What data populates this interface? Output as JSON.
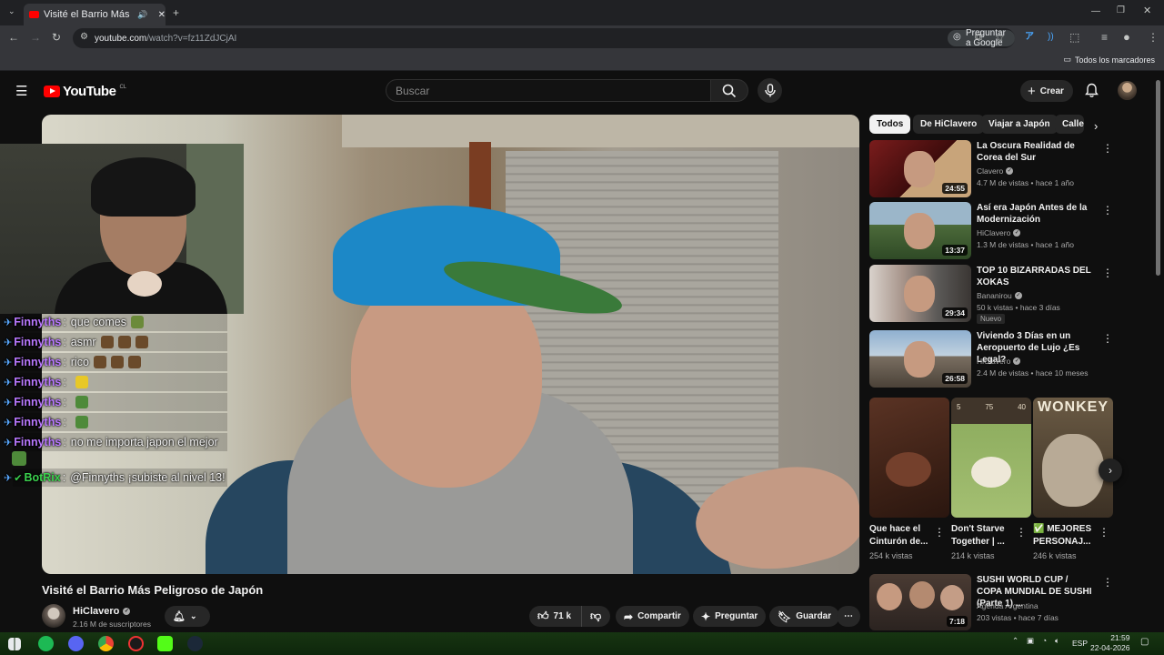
{
  "browser": {
    "tab_title": "Visité el Barrio Más Peligroso de Japón - YouTube",
    "url_host": "youtube.com",
    "url_path": "/watch?v=fz11ZdJCjAI",
    "google_pill": "Preguntar a Google",
    "bookmarks_all": "Todos los marcadores",
    "icons": [
      "back-icon",
      "forward-icon",
      "reload-icon",
      "site-info-icon",
      "bookmark-star-icon",
      "extensions-icon",
      "profile-icon",
      "menu-icon"
    ]
  },
  "youtube": {
    "logo_text": "YouTube",
    "country_code": "CL",
    "search_placeholder": "Buscar",
    "create_label": "Crear"
  },
  "stream_overlay": {
    "chat": [
      {
        "user": "Finnyths",
        "text": "que comes",
        "emote_colors": [
          "#6b8a3a"
        ]
      },
      {
        "user": "Finnyths",
        "text": "asmr",
        "emote_colors": [
          "#6a4a2a",
          "#6a4a2a",
          "#6a4a2a"
        ]
      },
      {
        "user": "Finnyths",
        "text": "rico",
        "emote_colors": [
          "#6a4a2a",
          "#6a4a2a",
          "#6a4a2a"
        ]
      },
      {
        "user": "Finnyths",
        "text": "",
        "emote_colors": [
          "#e8c827"
        ]
      },
      {
        "user": "Finnyths",
        "text": "",
        "emote_colors": [
          "#4e8a3a"
        ]
      },
      {
        "user": "Finnyths",
        "text": "",
        "emote_colors": [
          "#4e8a3a"
        ]
      },
      {
        "user": "Finnyths",
        "text": "no me importa japon el mejor",
        "emote_colors": []
      },
      {
        "user": "BotRix",
        "text": "@Finnyths ¡subiste al nivel 13!",
        "emote_colors": []
      }
    ]
  },
  "video": {
    "title": "Visité el Barrio Más Peligroso de Japón",
    "channel": "HiClavero",
    "subscribers": "2.16 M de suscriptores",
    "likes": "71 k",
    "share_label": "Compartir",
    "ask_label": "Preguntar",
    "save_label": "Guardar"
  },
  "chips": [
    "Todos",
    "De HiClavero",
    "Viajar a Japón",
    "Calle"
  ],
  "recommendations": [
    {
      "title": "La Oscura Realidad de Corea del Sur",
      "channel": "Clavero",
      "meta": "4.7 M de vistas • hace 1 año",
      "duration": "24:55",
      "badge": ""
    },
    {
      "title": "Así era Japón Antes de la Modernización",
      "channel": "HiClavero",
      "meta": "1.3 M de vistas • hace 1 año",
      "duration": "13:37",
      "badge": ""
    },
    {
      "title": "TOP 10 BIZARRADAS DEL XOKAS",
      "channel": "Bananirou",
      "meta": "50 k vistas • hace 3 días",
      "duration": "29:34",
      "badge": "Nuevo"
    },
    {
      "title": "Viviendo 3 Días en un Aeropuerto de Lujo ¿Es Legal?",
      "channel": "HiClavero",
      "meta": "2.4 M de vistas • hace 10 meses",
      "duration": "26:58",
      "badge": ""
    }
  ],
  "shelf": [
    {
      "title": "Que hace el Cinturón de...",
      "views": "254 k vistas"
    },
    {
      "title": "Don't Starve Together | ...",
      "views": "214 k vistas"
    },
    {
      "title": "✅ MEJORES PERSONAJ...",
      "views": "246 k vistas"
    }
  ],
  "shelf_card_numbers": [
    "5",
    "75",
    "40"
  ],
  "shelf_card_art_text": "WONKEY",
  "last_rec": {
    "title": "SUSHI WORLD CUP / COPA MUNDIAL DE SUSHI (Parte 1) ...",
    "channel": "Agenda Argentina",
    "meta": "203 vistas • hace 7 días",
    "duration": "7:18"
  },
  "taskbar": {
    "lang": "ESP",
    "time": "21:59",
    "date": "22-04-2026"
  }
}
